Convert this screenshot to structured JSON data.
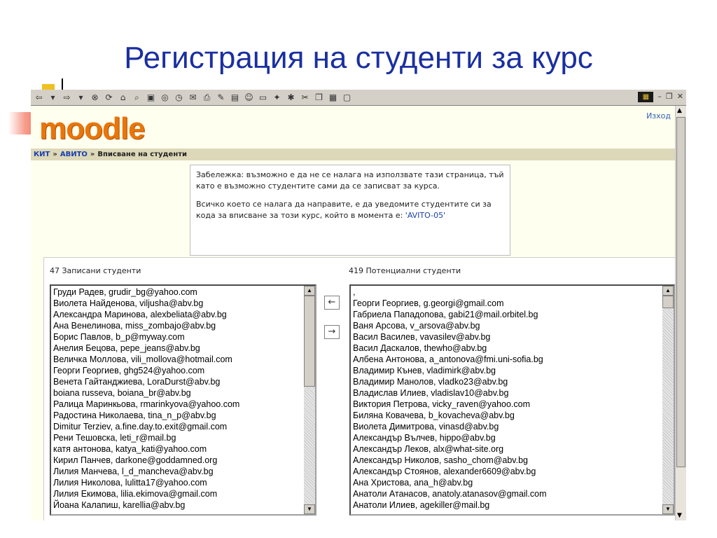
{
  "slide": {
    "title": "Регистрация на студенти за курс"
  },
  "toolbar": {
    "icons": [
      "back-icon",
      "forward-icon",
      "stop-icon",
      "refresh-icon",
      "home-icon",
      "search-icon",
      "favorites-icon",
      "media-icon",
      "history-icon",
      "mail-icon",
      "print-icon",
      "edit-icon",
      "discuss-icon",
      "messenger-icon",
      "window-icon",
      "tool-icon",
      "bug-icon",
      "cut-icon",
      "copy-icon",
      "paste-icon",
      "properties-icon"
    ],
    "window_controls": [
      "minimize-icon",
      "restore-icon",
      "close-icon"
    ]
  },
  "page": {
    "logo": "moodle",
    "logout": "Изход",
    "breadcrumb": {
      "home": "КИТ",
      "course": "АВИТО",
      "current": "Вписване на студенти",
      "separator": "»"
    }
  },
  "note": {
    "paragraph1": "Забележка: възможно е да не се налага на използвате тази страница, тъй като е възможно студентите сами да се записват за курса.",
    "paragraph2": "Всичко което се налага да направите, е да уведомите студентите си за кода за вписване за този курс, който в момента е:",
    "code": "'AVITO-05'"
  },
  "enrolled": {
    "label": "47 Записани студенти",
    "items": [
      "Груди Радев, grudir_bg@yahoo.com",
      "Виолета Найденова, viljusha@abv.bg",
      "Александра Маринова, alexbeliata@abv.bg",
      "Ана Венелинова, miss_zombajo@abv.bg",
      "Борис Павлов, b_p@myway.com",
      "Анелия Бецова, pepe_jeans@abv.bg",
      "Величка Моллова, vili_mollova@hotmail.com",
      "Георги Георгиев, ghg524@yahoo.com",
      "Венета Гайтанджиева, LoraDurst@abv.bg",
      "boiana russeva, boiana_br@abv.bg",
      "Ралица Маринкьова, rmarinkyova@yahoo.com",
      "Радостина Николаева, tina_n_p@abv.bg",
      "Dimitur Terziev, a.fine.day.to.exit@gmail.com",
      "Рени Тешовска, leti_r@mail.bg",
      "катя антонова, katya_kati@yahoo.com",
      "Кирил Панчев, darkone@goddamned.org",
      "Лилия Манчева, l_d_mancheva@abv.bg",
      "Лилия Николова, lulitta17@yahoo.com",
      "Лилия Екимова, lilia.ekimova@gmail.com",
      "Йоана Калапиш, karellia@abv.bg"
    ]
  },
  "potential": {
    "label": "419 Потенциални студенти",
    "items": [
      ",",
      " Георги Георгиев, g.georgi@gmail.com",
      "Габриела Пападопова, gabi21@mail.orbitel.bg",
      "Ваня Арсова, v_arsova@abv.bg",
      "Васил Василев, vavasilev@abv.bg",
      "Васил Даскалов, thewho@abv.bg",
      "Албена Антонова, a_antonova@fmi.uni-sofia.bg",
      "Владимир Кънев, vladimirk@abv.bg",
      "Владимир Манолов, vladko23@abv.bg",
      "Владислав Илиев, vladislav10@abv.bg",
      "Виктория Петрова, vicky_raven@yahoo.com",
      "Биляна Ковачева, b_kovacheva@abv.bg",
      "Виолета Димитрова, vinasd@abv.bg",
      "Александър Вълчев, hippo@abv.bg",
      "Александър Леков, alx@what-site.org",
      "Александър Николов, sasho_chom@abv.bg",
      "Александър Стоянов, alexander6609@abv.bg",
      "Ана Христова, ana_h@abv.bg",
      "Анатоли Атанасов, anatoly.atanasov@gmail.com",
      "Анатоли Илиев, agekiller@mail.bg"
    ]
  },
  "buttons": {
    "add": "←",
    "remove": "→"
  }
}
